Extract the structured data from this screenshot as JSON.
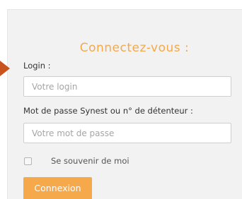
{
  "login_form": {
    "title": "Connectez-vous :",
    "login_label": "Login :",
    "login_placeholder": "Votre login",
    "login_value": "",
    "password_label": "Mot de passe Synest ou n° de détenteur :",
    "password_placeholder": "Votre mot de passe",
    "password_value": "",
    "remember_label": "Se souvenir de moi",
    "remember_checked": false,
    "submit_label": "Connexion"
  },
  "colors": {
    "accent": "#f5a94a",
    "pointer": "#c9531f",
    "panel_background": "#f2f2f2"
  }
}
